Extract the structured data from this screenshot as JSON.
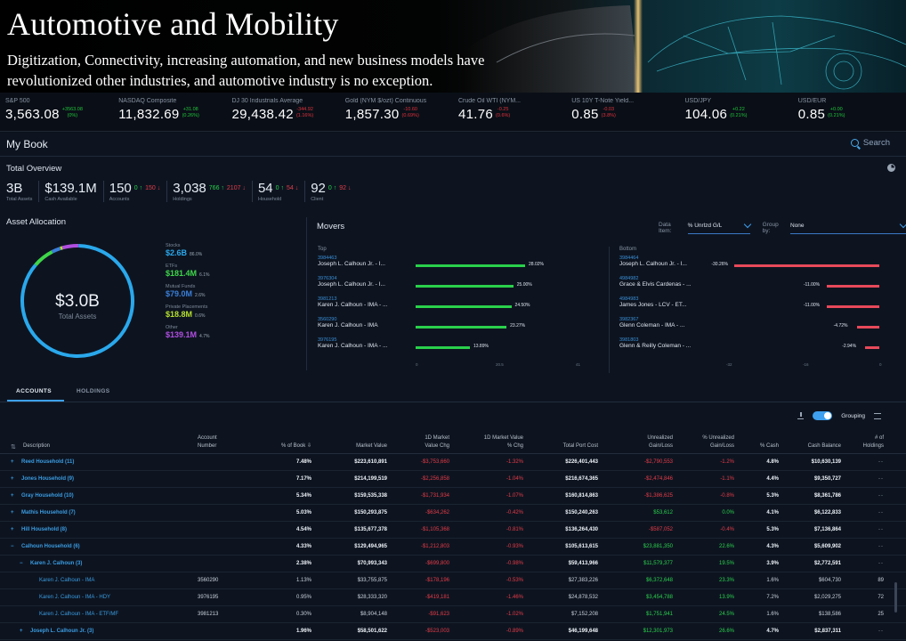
{
  "banner": {
    "title": "Automotive and Mobility",
    "subtitle": "Digitization, Connectivity, increasing automation, and new business models have revolutionized other industries, and automotive industry is no exception."
  },
  "ticker": [
    {
      "name": "S&P 500",
      "value": "3,563.08",
      "chg": "+3563.08",
      "pct": "(0%)",
      "dir": "up"
    },
    {
      "name": "NASDAQ Composite",
      "value": "11,832.69",
      "chg": "+31.08",
      "pct": "(0.26%)",
      "dir": "up"
    },
    {
      "name": "DJ 30 Industrials Average",
      "value": "29,438.42",
      "chg": "-344.92",
      "pct": "(1.16%)",
      "dir": "down"
    },
    {
      "name": "Gold (NYM $/ozt) Continuous",
      "value": "1,857.30",
      "chg": "-10.60",
      "pct": "(0.69%)",
      "dir": "down"
    },
    {
      "name": "Crude Oil WTI (NYM...",
      "value": "41.76",
      "chg": "-0.25",
      "pct": "(0.6%)",
      "dir": "down"
    },
    {
      "name": "US 10Y T-Note Yield...",
      "value": "0.85",
      "chg": "-0.03",
      "pct": "(3.8%)",
      "dir": "down"
    },
    {
      "name": "USD/JPY",
      "value": "104.06",
      "chg": "+0.22",
      "pct": "(0.21%)",
      "dir": "up"
    },
    {
      "name": "USD/EUR",
      "value": "0.85",
      "chg": "+0.00",
      "pct": "(0.21%)",
      "dir": "up"
    }
  ],
  "header": {
    "title": "My Book",
    "search_label": "Search"
  },
  "overview": {
    "title": "Total Overview",
    "stats": [
      {
        "value": "3B",
        "label": "Total Assets",
        "up": "",
        "down": ""
      },
      {
        "value": "$139.1M",
        "label": "Cash Available",
        "up": "",
        "down": ""
      },
      {
        "value": "150",
        "label": "Accounts",
        "up": "0 ↑",
        "down": "150 ↓"
      },
      {
        "value": "3,038",
        "label": "Holdings",
        "up": "766 ↑",
        "down": "2107 ↓"
      },
      {
        "value": "54",
        "label": "Household",
        "up": "0 ↑",
        "down": "54 ↓"
      },
      {
        "value": "92",
        "label": "Client",
        "up": "0 ↑",
        "down": "92 ↓"
      }
    ]
  },
  "allocation": {
    "title": "Asset Allocation",
    "center_value": "$3.0B",
    "center_label": "Total Assets",
    "items": [
      {
        "name": "Stocks",
        "value": "$2.6B",
        "pct": "86.0%",
        "color": "#2aa8ec",
        "share": 0.86
      },
      {
        "name": "ETFs",
        "value": "$181.4M",
        "pct": "6.1%",
        "color": "#3fd64a",
        "share": 0.061
      },
      {
        "name": "Mutual Funds",
        "value": "$79.0M",
        "pct": "2.6%",
        "color": "#3b7fd8",
        "share": 0.026
      },
      {
        "name": "Private Placements",
        "value": "$18.8M",
        "pct": "0.6%",
        "color": "#b6e02e",
        "share": 0.006
      },
      {
        "name": "Other",
        "value": "$139.1M",
        "pct": "4.7%",
        "color": "#b04ee0",
        "share": 0.047
      }
    ]
  },
  "movers": {
    "title": "Movers",
    "data_item_label": "Data Item:",
    "data_item_value": "% Unrlzd G/L",
    "group_by_label": "Group by:",
    "group_by_value": "None",
    "top_label": "Top",
    "bottom_label": "Bottom",
    "top": [
      {
        "id": "3984463",
        "name": "Joseph L. Calhoun Jr. - I...",
        "value": "28.02%",
        "pct": 28.02
      },
      {
        "id": "3976304",
        "name": "Joseph L. Calhoun Jr. - I...",
        "value": "25.00%",
        "pct": 25.0
      },
      {
        "id": "3981213",
        "name": "Karen J. Calhoun - IMA - ...",
        "value": "24.50%",
        "pct": 24.5
      },
      {
        "id": "3560290",
        "name": "Karen J. Calhoun - IMA",
        "value": "23.27%",
        "pct": 23.27
      },
      {
        "id": "3976195",
        "name": "Karen J. Calhoun - IMA - ...",
        "value": "13.89%",
        "pct": 13.89
      }
    ],
    "top_axis": [
      "0",
      "20.5",
      "41"
    ],
    "bottom": [
      {
        "id": "3984464",
        "name": "Joseph L. Calhoun Jr. - I...",
        "value": "-30.26%",
        "pct": -30.26
      },
      {
        "id": "4984982",
        "name": "Grace & Elvis Cardenas - ...",
        "value": "-11.00%",
        "pct": -11.0
      },
      {
        "id": "4984983",
        "name": "James Jones - LCV - ET...",
        "value": "-11.00%",
        "pct": -11.0
      },
      {
        "id": "3982367",
        "name": "Glenn Coleman - IMA - ...",
        "value": "-4.72%",
        "pct": -4.72
      },
      {
        "id": "3981803",
        "name": "Glenn & Reilly Coleman - ...",
        "value": "-2.94%",
        "pct": -2.94
      }
    ],
    "bottom_axis": [
      "-32",
      "-16",
      "0"
    ]
  },
  "tabs": [
    {
      "label": "ACCOUNTS",
      "active": true
    },
    {
      "label": "HOLDINGS",
      "active": false
    }
  ],
  "table_tools": {
    "grouping_label": "Grouping"
  },
  "table": {
    "headers": {
      "description": "Description",
      "account": "Account\nNumber",
      "pct_book": "% of Book ⇩",
      "market_value": "Market Value",
      "chg_1d": "1D Market\nValue Chg",
      "pct_chg_1d": "1D Market Value\n% Chg",
      "port_cost": "Total Port Cost",
      "unreal": "Unrealized\nGain/Loss",
      "pct_unreal": "% Unrealized\nGain/Loss",
      "pct_cash": "% Cash",
      "cash_bal": "Cash Balance",
      "holdings": "# of\nHoldings"
    },
    "rows": [
      {
        "toggle": "+",
        "level": 0,
        "desc": "Reed Household (11)",
        "acct": "",
        "pct": "7.48%",
        "mv": "$223,610,891",
        "chg": "-$3,753,660",
        "pchg": "-1.32%",
        "cost": "$226,401,443",
        "ug": "-$2,790,553",
        "pug": "-1.2%",
        "pcash": "4.8%",
        "cash": "$10,630,139",
        "hold": "--",
        "ugdir": "neg"
      },
      {
        "toggle": "+",
        "level": 0,
        "desc": "Jones Household (9)",
        "acct": "",
        "pct": "7.17%",
        "mv": "$214,199,519",
        "chg": "-$2,256,858",
        "pchg": "-1.04%",
        "cost": "$216,674,365",
        "ug": "-$2,474,846",
        "pug": "-1.1%",
        "pcash": "4.4%",
        "cash": "$9,350,727",
        "hold": "--",
        "ugdir": "neg"
      },
      {
        "toggle": "+",
        "level": 0,
        "desc": "Gray Household (10)",
        "acct": "",
        "pct": "5.34%",
        "mv": "$159,535,338",
        "chg": "-$1,731,934",
        "pchg": "-1.07%",
        "cost": "$160,814,863",
        "ug": "-$1,386,625",
        "pug": "-0.8%",
        "pcash": "5.3%",
        "cash": "$8,361,786",
        "hold": "--",
        "ugdir": "neg"
      },
      {
        "toggle": "+",
        "level": 0,
        "desc": "Mathis Household (7)",
        "acct": "",
        "pct": "5.03%",
        "mv": "$150,293,875",
        "chg": "-$634,262",
        "pchg": "-0.42%",
        "cost": "$150,240,263",
        "ug": "$53,612",
        "pug": "0.0%",
        "pcash": "4.1%",
        "cash": "$6,122,833",
        "hold": "--",
        "ugdir": "pos"
      },
      {
        "toggle": "+",
        "level": 0,
        "desc": "Hill Household (8)",
        "acct": "",
        "pct": "4.54%",
        "mv": "$135,677,378",
        "chg": "-$1,105,368",
        "pchg": "-0.81%",
        "cost": "$136,264,430",
        "ug": "-$587,052",
        "pug": "-0.4%",
        "pcash": "5.3%",
        "cash": "$7,136,864",
        "hold": "--",
        "ugdir": "neg"
      },
      {
        "toggle": "−",
        "level": 0,
        "desc": "Calhoun Household (6)",
        "acct": "",
        "pct": "4.33%",
        "mv": "$129,494,965",
        "chg": "-$1,212,803",
        "pchg": "-0.93%",
        "cost": "$105,613,615",
        "ug": "$23,881,350",
        "pug": "22.6%",
        "pcash": "4.3%",
        "cash": "$5,609,902",
        "hold": "--",
        "ugdir": "pos"
      },
      {
        "toggle": "−",
        "level": 1,
        "desc": "Karen J. Calhoun (3)",
        "acct": "",
        "pct": "2.38%",
        "mv": "$70,993,343",
        "chg": "-$699,800",
        "pchg": "-0.98%",
        "cost": "$59,413,966",
        "ug": "$11,579,377",
        "pug": "19.5%",
        "pcash": "3.9%",
        "cash": "$2,772,591",
        "hold": "--",
        "ugdir": "pos"
      },
      {
        "toggle": "",
        "level": 2,
        "desc": "Karen J. Calhoun - IMA",
        "acct": "3560290",
        "pct": "1.13%",
        "mv": "$33,755,875",
        "chg": "-$178,196",
        "pchg": "-0.53%",
        "cost": "$27,383,226",
        "ug": "$6,372,648",
        "pug": "23.3%",
        "pcash": "1.6%",
        "cash": "$604,730",
        "hold": "89",
        "ugdir": "pos"
      },
      {
        "toggle": "",
        "level": 2,
        "desc": "Karen J. Calhoun - IMA - HDY",
        "acct": "3976195",
        "pct": "0.95%",
        "mv": "$28,333,320",
        "chg": "-$419,181",
        "pchg": "-1.46%",
        "cost": "$24,878,532",
        "ug": "$3,454,788",
        "pug": "13.9%",
        "pcash": "7.2%",
        "cash": "$2,029,275",
        "hold": "72",
        "ugdir": "pos"
      },
      {
        "toggle": "",
        "level": 2,
        "desc": "Karen J. Calhoun - IMA - ETF/MF",
        "acct": "3981213",
        "pct": "0.30%",
        "mv": "$8,904,148",
        "chg": "-$91,623",
        "pchg": "-1.02%",
        "cost": "$7,152,208",
        "ug": "$1,751,941",
        "pug": "24.5%",
        "pcash": "1.6%",
        "cash": "$138,586",
        "hold": "25",
        "ugdir": "pos"
      },
      {
        "toggle": "+",
        "level": 1,
        "desc": "Joseph L. Calhoun Jr. (3)",
        "acct": "",
        "pct": "1.96%",
        "mv": "$58,501,622",
        "chg": "-$523,003",
        "pchg": "-0.89%",
        "cost": "$46,199,648",
        "ug": "$12,301,973",
        "pug": "26.6%",
        "pcash": "4.7%",
        "cash": "$2,837,311",
        "hold": "--",
        "ugdir": "pos"
      }
    ]
  }
}
